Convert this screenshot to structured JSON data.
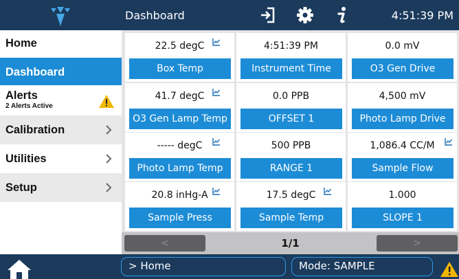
{
  "header": {
    "title": "Dashboard",
    "clock": "4:51:39 PM"
  },
  "sidebar": {
    "items": [
      {
        "label": "Home"
      },
      {
        "label": "Dashboard"
      },
      {
        "label": "Alerts",
        "sublabel": "2 Alerts Active"
      },
      {
        "label": "Calibration"
      },
      {
        "label": "Utilities"
      },
      {
        "label": "Setup"
      }
    ]
  },
  "tiles": [
    {
      "value": "22.5 degC",
      "label": "Box Temp"
    },
    {
      "value": "4:51:39 PM",
      "label": "Instrument Time"
    },
    {
      "value": "0.0 mV",
      "label": "O3 Gen Drive"
    },
    {
      "value": "41.7 degC",
      "label": "O3 Gen Lamp Temp"
    },
    {
      "value": "0.0 PPB",
      "label": "OFFSET 1"
    },
    {
      "value": "4,500 mV",
      "label": "Photo Lamp Drive"
    },
    {
      "value": "----- degC",
      "label": "Photo Lamp Temp"
    },
    {
      "value": "500 PPB",
      "label": "RANGE 1"
    },
    {
      "value": "1,086.4 CC/M",
      "label": "Sample Flow"
    },
    {
      "value": "20.8 inHg-A",
      "label": "Sample Press"
    },
    {
      "value": "17.5 degC",
      "label": "Sample Temp"
    },
    {
      "value": "1.000",
      "label": "SLOPE 1"
    }
  ],
  "pager": {
    "prev": "<",
    "next": ">",
    "page": "1/1"
  },
  "footer": {
    "breadcrumb": "> Home",
    "mode": "Mode: SAMPLE"
  },
  "colors": {
    "accent": "#1d8cd6",
    "bar": "#1b3a5c",
    "warning": "#f2b705"
  },
  "icons": [
    "logo-icon",
    "sign-in-icon",
    "gear-icon",
    "info-icon",
    "trend-chart-icon",
    "chevron-right-icon",
    "warning-icon",
    "home-icon"
  ]
}
